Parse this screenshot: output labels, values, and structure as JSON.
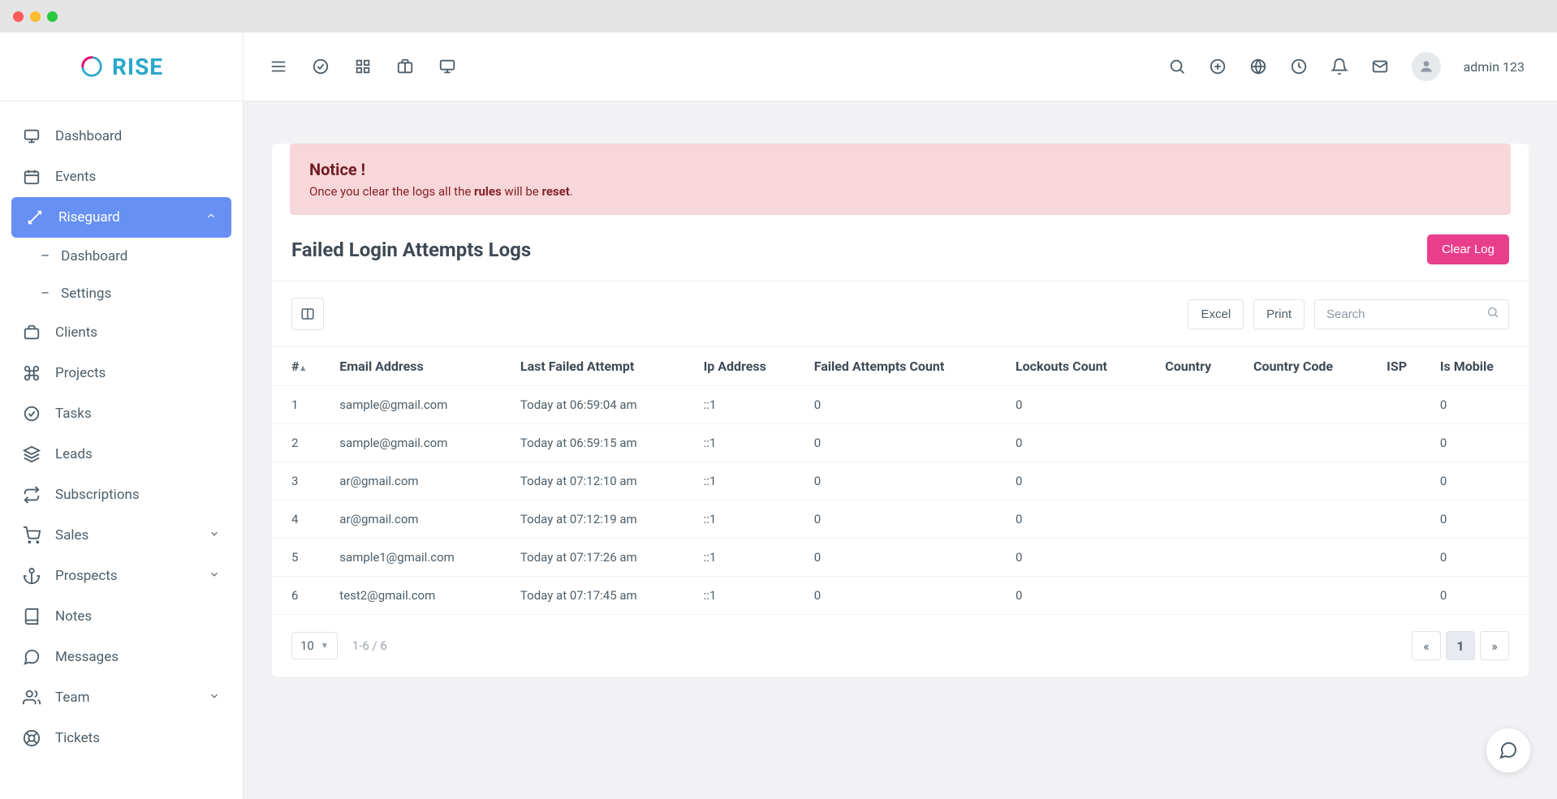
{
  "brand": {
    "name": "RISE"
  },
  "user": {
    "name": "admin 123"
  },
  "sidebar": {
    "dashboard": "Dashboard",
    "events": "Events",
    "riseguard": "Riseguard",
    "riseguard_sub": {
      "dashboard": "Dashboard",
      "settings": "Settings"
    },
    "clients": "Clients",
    "projects": "Projects",
    "tasks": "Tasks",
    "leads": "Leads",
    "subscriptions": "Subscriptions",
    "sales": "Sales",
    "prospects": "Prospects",
    "notes": "Notes",
    "messages": "Messages",
    "team": "Team",
    "tickets": "Tickets"
  },
  "notice": {
    "title": "Notice !",
    "text_prefix": "Once you clear the logs all the ",
    "bold_rules": "rules",
    "text_middle": " will be ",
    "bold_reset": "reset",
    "text_suffix": "."
  },
  "page": {
    "title": "Failed Login Attempts Logs",
    "clear_button": "Clear Log"
  },
  "toolbar": {
    "excel": "Excel",
    "print": "Print",
    "search_placeholder": "Search"
  },
  "table": {
    "headers": {
      "index": "#",
      "email": "Email Address",
      "last_attempt": "Last Failed Attempt",
      "ip": "Ip Address",
      "failed_count": "Failed Attempts Count",
      "lockouts": "Lockouts Count",
      "country": "Country",
      "country_code": "Country Code",
      "isp": "ISP",
      "is_mobile": "Is Mobile"
    },
    "rows": [
      {
        "index": "1",
        "email": "sample@gmail.com",
        "last_attempt": "Today at 06:59:04 am",
        "ip": "::1",
        "failed_count": "0",
        "lockouts": "0",
        "country": "",
        "country_code": "",
        "isp": "",
        "is_mobile": "0"
      },
      {
        "index": "2",
        "email": "sample@gmail.com",
        "last_attempt": "Today at 06:59:15 am",
        "ip": "::1",
        "failed_count": "0",
        "lockouts": "0",
        "country": "",
        "country_code": "",
        "isp": "",
        "is_mobile": "0"
      },
      {
        "index": "3",
        "email": "ar@gmail.com",
        "last_attempt": "Today at 07:12:10 am",
        "ip": "::1",
        "failed_count": "0",
        "lockouts": "0",
        "country": "",
        "country_code": "",
        "isp": "",
        "is_mobile": "0"
      },
      {
        "index": "4",
        "email": "ar@gmail.com",
        "last_attempt": "Today at 07:12:19 am",
        "ip": "::1",
        "failed_count": "0",
        "lockouts": "0",
        "country": "",
        "country_code": "",
        "isp": "",
        "is_mobile": "0"
      },
      {
        "index": "5",
        "email": "sample1@gmail.com",
        "last_attempt": "Today at 07:17:26 am",
        "ip": "::1",
        "failed_count": "0",
        "lockouts": "0",
        "country": "",
        "country_code": "",
        "isp": "",
        "is_mobile": "0"
      },
      {
        "index": "6",
        "email": "test2@gmail.com",
        "last_attempt": "Today at 07:17:45 am",
        "ip": "::1",
        "failed_count": "0",
        "lockouts": "0",
        "country": "",
        "country_code": "",
        "isp": "",
        "is_mobile": "0"
      }
    ]
  },
  "footer": {
    "page_size": "10",
    "range": "1-6 / 6",
    "current_page": "1"
  }
}
